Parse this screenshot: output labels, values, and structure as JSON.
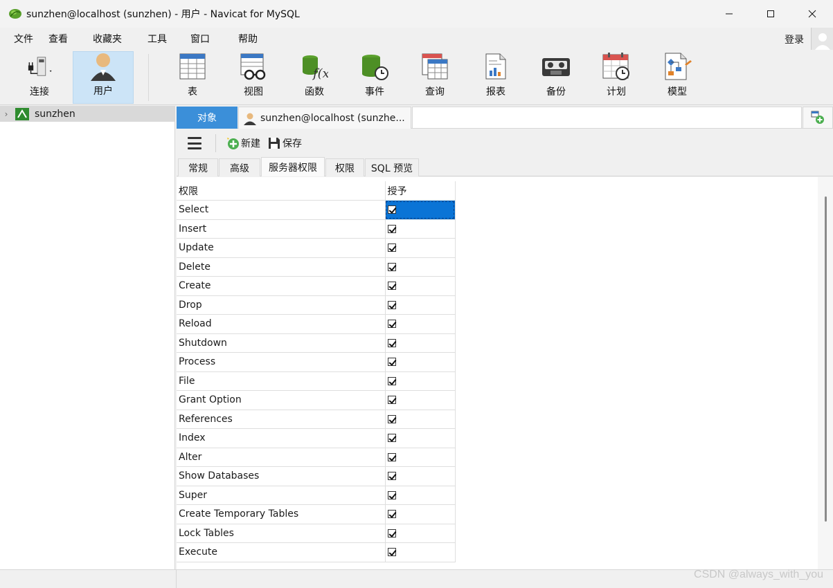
{
  "window": {
    "title": "sunzhen@localhost (sunzhen) - 用户 - Navicat for MySQL"
  },
  "menu": {
    "items": [
      "文件",
      "查看",
      "收藏夹",
      "工具",
      "窗口",
      "帮助"
    ],
    "login_label": "登录"
  },
  "toolbar": {
    "items": [
      {
        "label": "连接",
        "icon": "plug-icon"
      },
      {
        "label": "用户",
        "icon": "user-icon"
      },
      {
        "label": "表",
        "icon": "table-icon"
      },
      {
        "label": "视图",
        "icon": "view-icon"
      },
      {
        "label": "函数",
        "icon": "function-icon"
      },
      {
        "label": "事件",
        "icon": "event-icon"
      },
      {
        "label": "查询",
        "icon": "query-icon"
      },
      {
        "label": "报表",
        "icon": "report-icon"
      },
      {
        "label": "备份",
        "icon": "backup-icon"
      },
      {
        "label": "计划",
        "icon": "schedule-icon"
      },
      {
        "label": "模型",
        "icon": "model-icon"
      }
    ]
  },
  "sidebar": {
    "connection_name": "sunzhen"
  },
  "tabs": {
    "object_label": "对象",
    "user_tab_label": "sunzhen@localhost (sunzhe..."
  },
  "subtoolbar": {
    "new_label": "新建",
    "save_label": "保存"
  },
  "inner_tabs": [
    "常规",
    "高级",
    "服务器权限",
    "权限",
    "SQL 预览"
  ],
  "grid": {
    "headers": [
      "权限",
      "授予"
    ],
    "rows": [
      {
        "privilege": "Select",
        "granted": true
      },
      {
        "privilege": "Insert",
        "granted": true
      },
      {
        "privilege": "Update",
        "granted": true
      },
      {
        "privilege": "Delete",
        "granted": true
      },
      {
        "privilege": "Create",
        "granted": true
      },
      {
        "privilege": "Drop",
        "granted": true
      },
      {
        "privilege": "Reload",
        "granted": true
      },
      {
        "privilege": "Shutdown",
        "granted": true
      },
      {
        "privilege": "Process",
        "granted": true
      },
      {
        "privilege": "File",
        "granted": true
      },
      {
        "privilege": "Grant Option",
        "granted": true
      },
      {
        "privilege": "References",
        "granted": true
      },
      {
        "privilege": "Index",
        "granted": true
      },
      {
        "privilege": "Alter",
        "granted": true
      },
      {
        "privilege": "Show Databases",
        "granted": true
      },
      {
        "privilege": "Super",
        "granted": true
      },
      {
        "privilege": "Create Temporary Tables",
        "granted": true
      },
      {
        "privilege": "Lock Tables",
        "granted": true
      },
      {
        "privilege": "Execute",
        "granted": true
      }
    ]
  },
  "watermark": "CSDN @always_with_you",
  "colors": {
    "accent": "#3b8fd9",
    "selection": "#0a74d6"
  }
}
